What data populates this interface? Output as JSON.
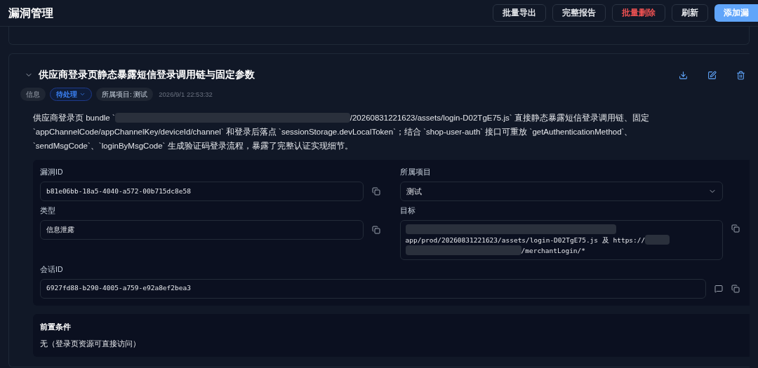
{
  "header": {
    "title": "漏洞管理",
    "buttons": [
      {
        "label": "批量导出",
        "kind": "default"
      },
      {
        "label": "完整报告",
        "kind": "default"
      },
      {
        "label": "批量删除",
        "kind": "danger"
      },
      {
        "label": "刷新",
        "kind": "default"
      },
      {
        "label": "添加漏",
        "kind": "primary"
      }
    ]
  },
  "vulnerability": {
    "title": "供应商登录页静态暴露短信登录调用链与固定参数",
    "expanded": true,
    "tags": [
      {
        "label": "信息",
        "kind": "severity"
      },
      {
        "label": "待处理",
        "kind": "status"
      },
      {
        "label": "所属项目: 测试",
        "kind": "project"
      }
    ],
    "time": "2026/9/1 22:53:32",
    "description": [
      {
        "kind": "text",
        "text": "供应商登录页 bundle `"
      },
      {
        "kind": "redacted"
      },
      {
        "kind": "text",
        "text": "/20260831221623/assets/login-D02TgE75.js` 直接静态暴露短信登录调用链、固定"
      },
      {
        "kind": "paragraph",
        "text": "`appChannelCode/appChannelKey/deviceId/channel` 和登录后落点 `sessionStorage.devLocalToken`；结合 `shop-user-auth` 接口可重放 `getAuthenticationMethod`、`sendMsgCode`、`loginByMsgCode` 生成验证码登录流程，暴露了完整认证实现细节。"
      }
    ],
    "fields": [
      {
        "label": "漏洞ID",
        "kind": "text",
        "value": "b81e06bb-18a5-4040-a572-00b715dc8e58",
        "copyable": true,
        "commentable": false
      },
      {
        "label": "所属项目",
        "kind": "select",
        "value": "测试",
        "copyable": false,
        "commentable": false
      },
      {
        "label": "类型",
        "kind": "text",
        "value": "信息泄露",
        "copyable": true,
        "commentable": false
      },
      {
        "label": "目标",
        "kind": "multiline",
        "lines": [
          [
            {
              "kind": "redacted"
            }
          ],
          [
            {
              "kind": "text",
              "text": "app/prod/20260831221623/assets/login-D02TgE75.js 及 https://"
            },
            {
              "kind": "redacted"
            }
          ],
          [
            {
              "kind": "redacted"
            },
            {
              "kind": "text",
              "text": "/merchantLogin/*"
            }
          ]
        ],
        "copyable": true,
        "commentable": false
      },
      {
        "label": "会话ID",
        "kind": "wide",
        "value": "6927fd88-b290-4005-a759-e92a8ef2bea3",
        "copyable": true,
        "commentable": true
      }
    ],
    "precondition": {
      "title": "前置条件",
      "text": "无（登录页资源可直接访问）"
    }
  }
}
